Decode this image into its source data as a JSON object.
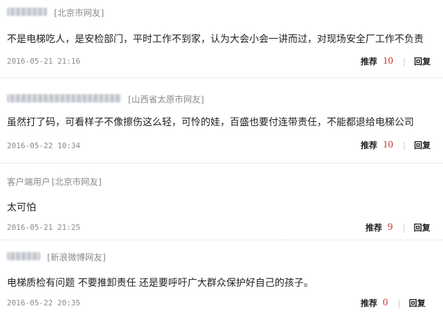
{
  "comments": [
    {
      "username": "",
      "location": "[北京市网友]",
      "text": "不是电梯吃人，是安检部门，平时工作不到家，认为大会小会一讲而过，对现场安全厂工作不负责",
      "time": "2016-05-21 21:16",
      "recommend_label": "推荐",
      "recommend_count": "10",
      "divider": "|",
      "reply_label": "回复"
    },
    {
      "username": "",
      "location": "[山西省太原市网友]",
      "text": "虽然打了码，可看样子不像擦伤这么轻，可怜的娃，百盛也要付连带责任，不能都退给电梯公司",
      "time": "2016-05-22 10:34",
      "recommend_label": "推荐",
      "recommend_count": "10",
      "divider": "|",
      "reply_label": "回复"
    },
    {
      "username": "客户端用户",
      "location": "[北京市网友]",
      "text": "太可怕",
      "time": "2016-05-21 21:25",
      "recommend_label": "推荐",
      "recommend_count": "9",
      "divider": "|",
      "reply_label": "回复"
    },
    {
      "username": "",
      "location": "[新浪微博网友]",
      "text": "电梯质检有问题 不要推卸责任 还是要呼吁广大群众保护好自己的孩子。",
      "time": "2016-05-22 20:35",
      "recommend_label": "推荐",
      "recommend_count": "0",
      "divider": "|",
      "reply_label": "回复"
    }
  ],
  "colors": {
    "count": "#c0392b",
    "meta": "#8a8a8a",
    "text": "#222222"
  }
}
